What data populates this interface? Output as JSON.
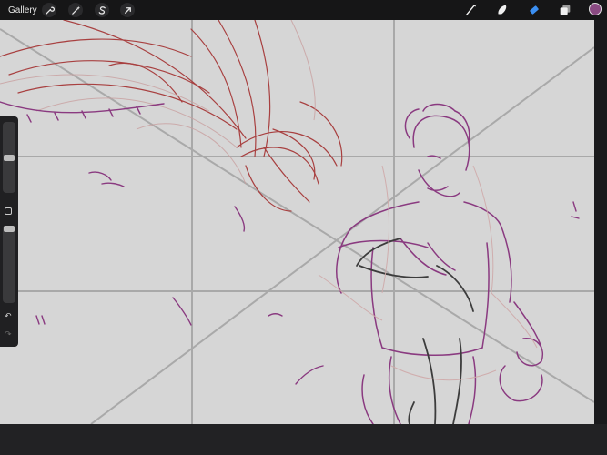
{
  "topbar": {
    "gallery_label": "Gallery",
    "left_tools": [
      "wrench-icon",
      "magic-wand-icon",
      "selection-s-icon",
      "transform-arrow-icon"
    ],
    "right_tools": [
      "brush-icon",
      "smudge-icon",
      "eraser-icon",
      "layers-icon"
    ],
    "active_tool": "eraser-icon",
    "current_color": "#8a4a82"
  },
  "sidebar": {
    "size_slider_level": 0.5,
    "opacity_slider_level": 1.0,
    "icons": [
      "modify-square-icon",
      "undo-icon",
      "redo-icon"
    ]
  },
  "colors": {
    "canvas": "#d6d6d6",
    "sketch_purple": "#8a3a80",
    "sketch_red": "#a84040",
    "sketch_dark": "#3c3c3c",
    "guide_gray": "#a9a9a9",
    "accent_blue": "#3b8ff2"
  }
}
